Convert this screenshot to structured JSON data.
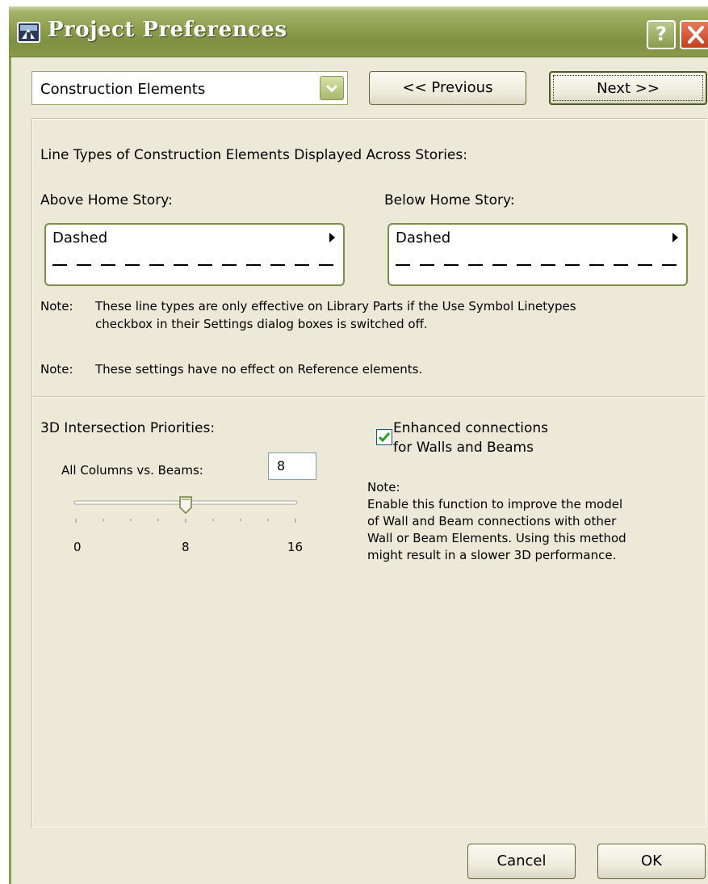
{
  "window": {
    "title": "Project Preferences",
    "help_label": "?"
  },
  "toolbar": {
    "category_value": "Construction Elements",
    "previous_label": "<< Previous",
    "next_label": "Next >>"
  },
  "line_types": {
    "heading": "Line Types of Construction Elements Displayed Across Stories:",
    "above_label": "Above Home Story:",
    "above_value": "Dashed",
    "below_label": "Below Home Story:",
    "below_value": "Dashed",
    "note1_prefix": "Note:",
    "note1_line1": "These line types are only effective on Library Parts if the Use Symbol Linetypes",
    "note1_line2": "checkbox in their Settings dialog boxes is switched off.",
    "note2_prefix": "Note:",
    "note2_text": "These settings have no effect on Reference elements."
  },
  "intersection": {
    "heading": "3D Intersection Priorities:",
    "columns_label": "All Columns vs. Beams:",
    "columns_value": "8",
    "slider_min": "0",
    "slider_mid": "8",
    "slider_max": "16",
    "slider_fraction": 0.5
  },
  "connections": {
    "checkbox_line1": "Enhanced connections",
    "checkbox_line2": "for Walls and Beams",
    "checked": true,
    "note_title": "Note:",
    "note_line1": "Enable this function to improve the model",
    "note_line2": "of Wall and Beam connections with other",
    "note_line3": "Wall or Beam Elements. Using this method",
    "note_line4": "might result in a slower 3D performance."
  },
  "footer": {
    "cancel_label": "Cancel",
    "ok_label": "OK"
  },
  "colors": {
    "titlebar": "#8e9f4f",
    "dialog_bg": "#ece9d8",
    "close_button": "#c3401d",
    "check_mark": "#21a121"
  }
}
